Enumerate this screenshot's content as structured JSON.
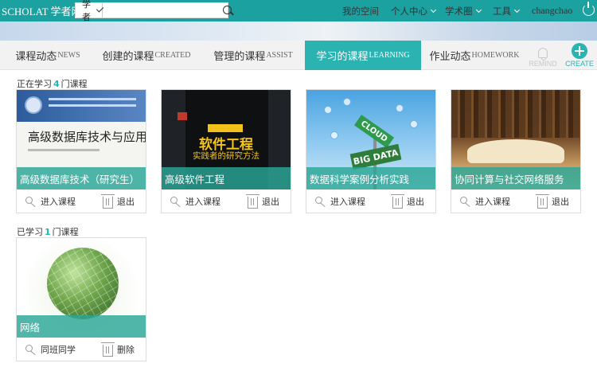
{
  "header": {
    "brand": "SCHOLAT 学者网",
    "search_scope": "学者",
    "search_value": "",
    "nav": {
      "my_space": "我的空间",
      "personal_center": "个人中心",
      "academic_circle": "学术圈",
      "tools": "工具",
      "username": "changchao"
    }
  },
  "tabs": [
    {
      "zh": "课程动态",
      "en": "NEWS"
    },
    {
      "zh": "创建的课程",
      "en": "CREATED"
    },
    {
      "zh": "管理的课程",
      "en": "ASSIST"
    },
    {
      "zh": "学习的课程",
      "en": "LEARNING"
    },
    {
      "zh": "作业动态",
      "en": "HOMEWORK"
    }
  ],
  "toolbar": {
    "remind_label": "REMIND",
    "create_label": "CREATE"
  },
  "current": {
    "prefix": "正在学习",
    "count": "4",
    "suffix": "门课程",
    "courses": [
      {
        "title": "高级数据库技术（研究生）",
        "cover_title": "高级数据库技术与应用",
        "enter": "进入课程",
        "exit": "退出"
      },
      {
        "title": "高级软件工程",
        "cover_title": "软件工程",
        "cover_subtitle": "实践者的研究方法",
        "enter": "进入课程",
        "exit": "退出"
      },
      {
        "title": "数据科学案例分析实践",
        "cover_sign_1": "CLOUD",
        "cover_sign_2": "BIG DATA",
        "enter": "进入课程",
        "exit": "退出"
      },
      {
        "title": "协同计算与社交网络服务",
        "enter": "进入课程",
        "exit": "退出"
      }
    ]
  },
  "done": {
    "prefix": "已学习",
    "count": "1",
    "suffix": "门课程",
    "courses": [
      {
        "title": "网络",
        "classmates": "同班同学",
        "delete": "删除"
      }
    ]
  },
  "colors": {
    "brand_teal": "#1aa1a0",
    "active_tab": "#2ab3b1"
  }
}
